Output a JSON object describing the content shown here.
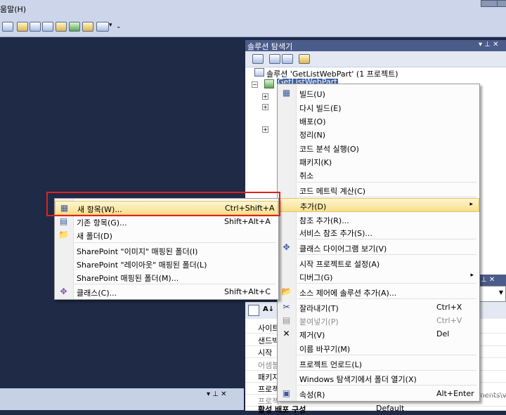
{
  "menubar": {
    "help": "움말(H)"
  },
  "toolbar": {
    "dropdown_glyph": "▾",
    "overflow_glyph": "⌄"
  },
  "solution_explorer": {
    "title": "솔루션 탐색기",
    "title_controls": "▾ ⊥ ✕",
    "solution_label": "솔루션 'GetListWebPart' (1 프로젝트)",
    "project_label": "GetListWebPart",
    "expander_glyph": "+"
  },
  "properties": {
    "title_controls": "⊥ ✕",
    "toolbar_sort": "A↓",
    "partial_header": "ments\\vi",
    "rows": [
      "사이트",
      "샌드박",
      "시작 ",
      "어셈블",
      "패키지",
      "프로젝",
      "프로젝"
    ],
    "bottom_row_label": "활성 배포 구성",
    "bottom_row_value": "Default"
  },
  "bottom_pane": {
    "title_controls": "▾ ⊥ ✕"
  },
  "context_menu": {
    "items": [
      {
        "label": "빌드(U)",
        "icon": "build-icon",
        "glyph": "▦"
      },
      {
        "label": "다시 빌드(E)"
      },
      {
        "label": "배포(O)"
      },
      {
        "label": "정리(N)"
      },
      {
        "label": "코드 분석 실행(O)"
      },
      {
        "label": "패키지(K)"
      },
      {
        "label": "취소"
      },
      {
        "label": "코드 메트릭 계산(C)"
      },
      {
        "label": "추가(D)",
        "submenu": "▸"
      },
      {
        "label": "참조 추가(R)..."
      },
      {
        "label": "서비스 참조 추가(S)..."
      },
      {
        "label": "클래스 다이어그램 보기(V)",
        "icon": "class-diagram-icon",
        "glyph": "✥"
      },
      {
        "label": "시작 프로젝트로 설정(A)"
      },
      {
        "label": "디버그(G)",
        "submenu": "▸"
      },
      {
        "label": "소스 제어에 솔루션 추가(A)...",
        "icon": "source-control-icon",
        "glyph": "📂"
      },
      {
        "label": "잘라내기(T)",
        "shortcut": "Ctrl+X",
        "icon": "scissors-icon",
        "glyph": "✂"
      },
      {
        "label": "붙여넣기(P)",
        "shortcut": "Ctrl+V",
        "icon": "paste-icon",
        "glyph": "▤",
        "disabled": true
      },
      {
        "label": "제거(V)",
        "shortcut": "Del",
        "icon": "remove-icon",
        "glyph": "✕"
      },
      {
        "label": "이름 바꾸기(M)"
      },
      {
        "label": "프로젝트 언로드(L)"
      },
      {
        "label": "Windows 탐색기에서 폴더 열기(X)"
      },
      {
        "label": "속성(R)",
        "shortcut": "Alt+Enter",
        "icon": "properties-icon",
        "glyph": "▣"
      }
    ]
  },
  "add_submenu": {
    "items": [
      {
        "label": "새 항목(W)...",
        "shortcut": "Ctrl+Shift+A",
        "icon": "new-item-icon",
        "glyph": "▦"
      },
      {
        "label": "기존 항목(G)...",
        "shortcut": "Shift+Alt+A",
        "icon": "existing-item-icon",
        "glyph": "▤"
      },
      {
        "label": "새 폴더(D)",
        "icon": "folder-icon",
        "glyph": "📁"
      },
      {
        "label": "SharePoint \"이미지\" 매핑된 폴더(I)"
      },
      {
        "label": "SharePoint \"레이아웃\" 매핑된 폴더(L)"
      },
      {
        "label": "SharePoint 매핑된 폴더(M)..."
      },
      {
        "label": "클래스(C)...",
        "shortcut": "Shift+Alt+C",
        "icon": "class-icon",
        "glyph": "✥"
      }
    ]
  }
}
